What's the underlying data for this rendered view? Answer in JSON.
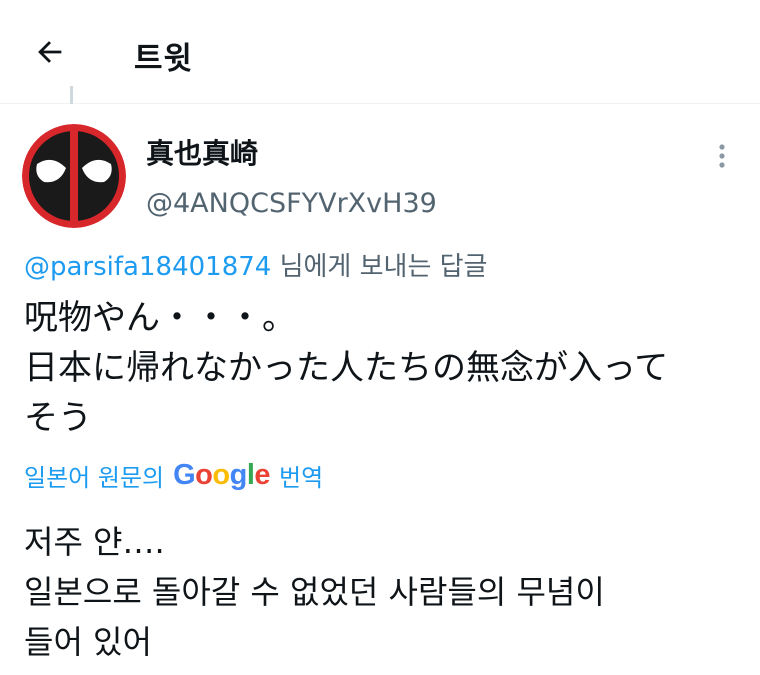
{
  "header": {
    "title": "트윗"
  },
  "author": {
    "display_name": "真也真崎",
    "handle": "@4ANQCSFYVrXvH39",
    "avatar_icon": "deadpool-mask-avatar"
  },
  "reply": {
    "mention": "@parsifa18401874",
    "suffix": " 님에게 보내는 답글"
  },
  "tweet": {
    "text": "呪物やん・・・。\n日本に帰れなかった人たちの無念が入って\nそう"
  },
  "translation": {
    "prefix": "일본어 원문의",
    "brand": {
      "letters": [
        "G",
        "o",
        "o",
        "g",
        "l",
        "e"
      ],
      "colors": [
        "#4285f4",
        "#ea4335",
        "#fbbc05",
        "#4285f4",
        "#34a853",
        "#ea4335"
      ]
    },
    "suffix": "번역",
    "text": "저주 얀….\n일본으로 돌아갈 수 없었던 사람들의 무념이\n들어 있어"
  },
  "colors": {
    "link": "#1d9bf0",
    "secondary_text": "#536471",
    "primary_text": "#0f1419",
    "avatar_red": "#d7272b"
  }
}
